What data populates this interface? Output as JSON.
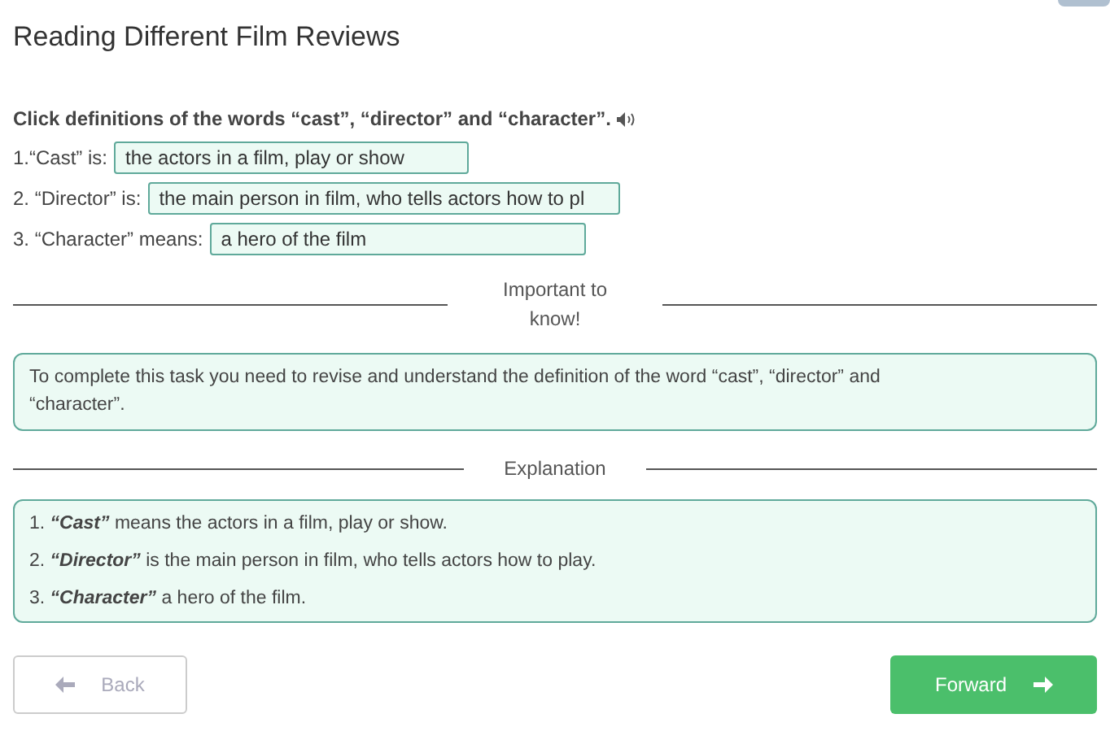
{
  "title": "Reading Different Film Reviews",
  "instruction": "Click definitions of the words “cast”, “director” and “character”.",
  "questions": [
    {
      "label": "1.“Cast” is:",
      "answer": "the actors in a film, play or show"
    },
    {
      "label": "2. “Director” is:",
      "answer": "the main person in film, who tells actors how to pl"
    },
    {
      "label": "3. “Character” means:",
      "answer": "a hero of the film"
    }
  ],
  "important": {
    "heading": "Important to know!",
    "text": "To complete this task you need to revise and understand the definition of the word “cast”, “director” and “character”."
  },
  "explanation": {
    "heading": "Explanation",
    "items": [
      {
        "number": "1.",
        "term": "“Cast”",
        "text": "means the actors in a film, play or show."
      },
      {
        "number": "2.",
        "term": "“Director”",
        "text": "is the main person in film, who tells actors how to play."
      },
      {
        "number": "3.",
        "term": "“Character”",
        "text": "a hero of the film."
      }
    ]
  },
  "buttons": {
    "back": {
      "label": "Back",
      "disabled": true
    },
    "forward": {
      "label": "Forward",
      "disabled": false
    }
  }
}
